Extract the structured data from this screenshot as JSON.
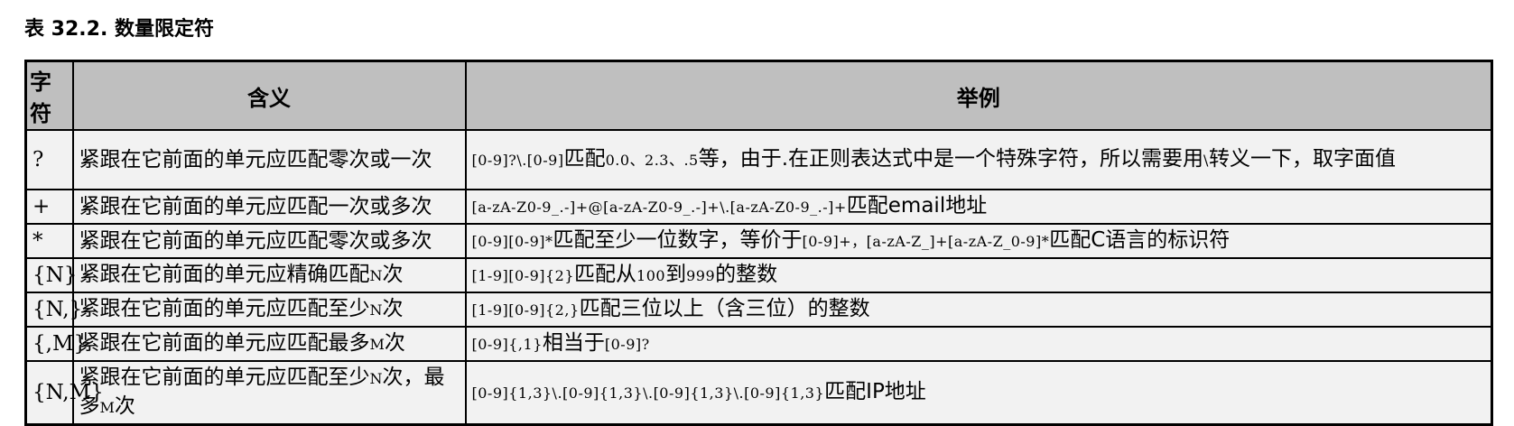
{
  "caption": "表 32.2. 数量限定符",
  "headers": {
    "symbol": "字符",
    "meaning": "含义",
    "example": "举例"
  },
  "rows": [
    {
      "symbol": "?",
      "meaning": "紧跟在它前面的单元应匹配零次或一次",
      "example": [
        {
          "t": "code",
          "v": "[0-9]?\\.[0-9]"
        },
        {
          "t": "cn",
          "v": "匹配"
        },
        {
          "t": "code",
          "v": "0.0、2.3、.5"
        },
        {
          "t": "cn",
          "v": "等，由于."
        },
        {
          "t": "cn",
          "v": "在正则表达式中是一个特殊字符，所以需要用"
        },
        {
          "t": "code",
          "v": "\\"
        },
        {
          "t": "cn",
          "v": "转义一下，取字面值"
        }
      ]
    },
    {
      "symbol": "+",
      "meaning": "紧跟在它前面的单元应匹配一次或多次",
      "example": [
        {
          "t": "code",
          "v": "[a-zA-Z0-9_.-]+@[a-zA-Z0-9_.-]+\\.[a-zA-Z0-9_.-]+"
        },
        {
          "t": "cn",
          "v": "匹配email地址"
        }
      ]
    },
    {
      "symbol": "*",
      "meaning": "紧跟在它前面的单元应匹配零次或多次",
      "example": [
        {
          "t": "code",
          "v": "[0-9][0-9]*"
        },
        {
          "t": "cn",
          "v": "匹配至少一位数字，等价于"
        },
        {
          "t": "code",
          "v": "[0-9]+，[a-zA-Z_]+[a-zA-Z_0-9]*"
        },
        {
          "t": "cn",
          "v": "匹配C语言的标识符"
        }
      ]
    },
    {
      "symbol": "{N}",
      "meaning_parts": [
        {
          "t": "cn",
          "v": "紧跟在它前面的单元应精确匹配"
        },
        {
          "t": "sm",
          "v": "N"
        },
        {
          "t": "cn",
          "v": "次"
        }
      ],
      "example": [
        {
          "t": "code",
          "v": "[1-9][0-9]{2}"
        },
        {
          "t": "cn",
          "v": "匹配从"
        },
        {
          "t": "code",
          "v": "100"
        },
        {
          "t": "cn",
          "v": "到"
        },
        {
          "t": "code",
          "v": "999"
        },
        {
          "t": "cn",
          "v": "的整数"
        }
      ]
    },
    {
      "symbol": "{N,}",
      "meaning_parts": [
        {
          "t": "cn",
          "v": "紧跟在它前面的单元应匹配至少"
        },
        {
          "t": "sm",
          "v": "N"
        },
        {
          "t": "cn",
          "v": "次"
        }
      ],
      "example": [
        {
          "t": "code",
          "v": "[1-9][0-9]{2,}"
        },
        {
          "t": "cn",
          "v": "匹配三位以上（含三位）的整数"
        }
      ]
    },
    {
      "symbol": "{,M}",
      "meaning_parts": [
        {
          "t": "cn",
          "v": "紧跟在它前面的单元应匹配最多"
        },
        {
          "t": "sm",
          "v": "M"
        },
        {
          "t": "cn",
          "v": "次"
        }
      ],
      "example": [
        {
          "t": "code",
          "v": "[0-9]{,1}"
        },
        {
          "t": "cn",
          "v": "相当于"
        },
        {
          "t": "code",
          "v": "[0-9]?"
        }
      ]
    },
    {
      "symbol": "{N,M}",
      "meaning_parts": [
        {
          "t": "cn",
          "v": "紧跟在它前面的单元应匹配至少"
        },
        {
          "t": "sm",
          "v": "N"
        },
        {
          "t": "cn",
          "v": "次，最多"
        },
        {
          "t": "sm",
          "v": "M"
        },
        {
          "t": "cn",
          "v": "次"
        }
      ],
      "example": [
        {
          "t": "code",
          "v": "[0-9]{1,3}\\.[0-9]{1,3}\\.[0-9]{1,3}\\.[0-9]{1,3}"
        },
        {
          "t": "cn",
          "v": "匹配IP地址"
        }
      ]
    }
  ]
}
